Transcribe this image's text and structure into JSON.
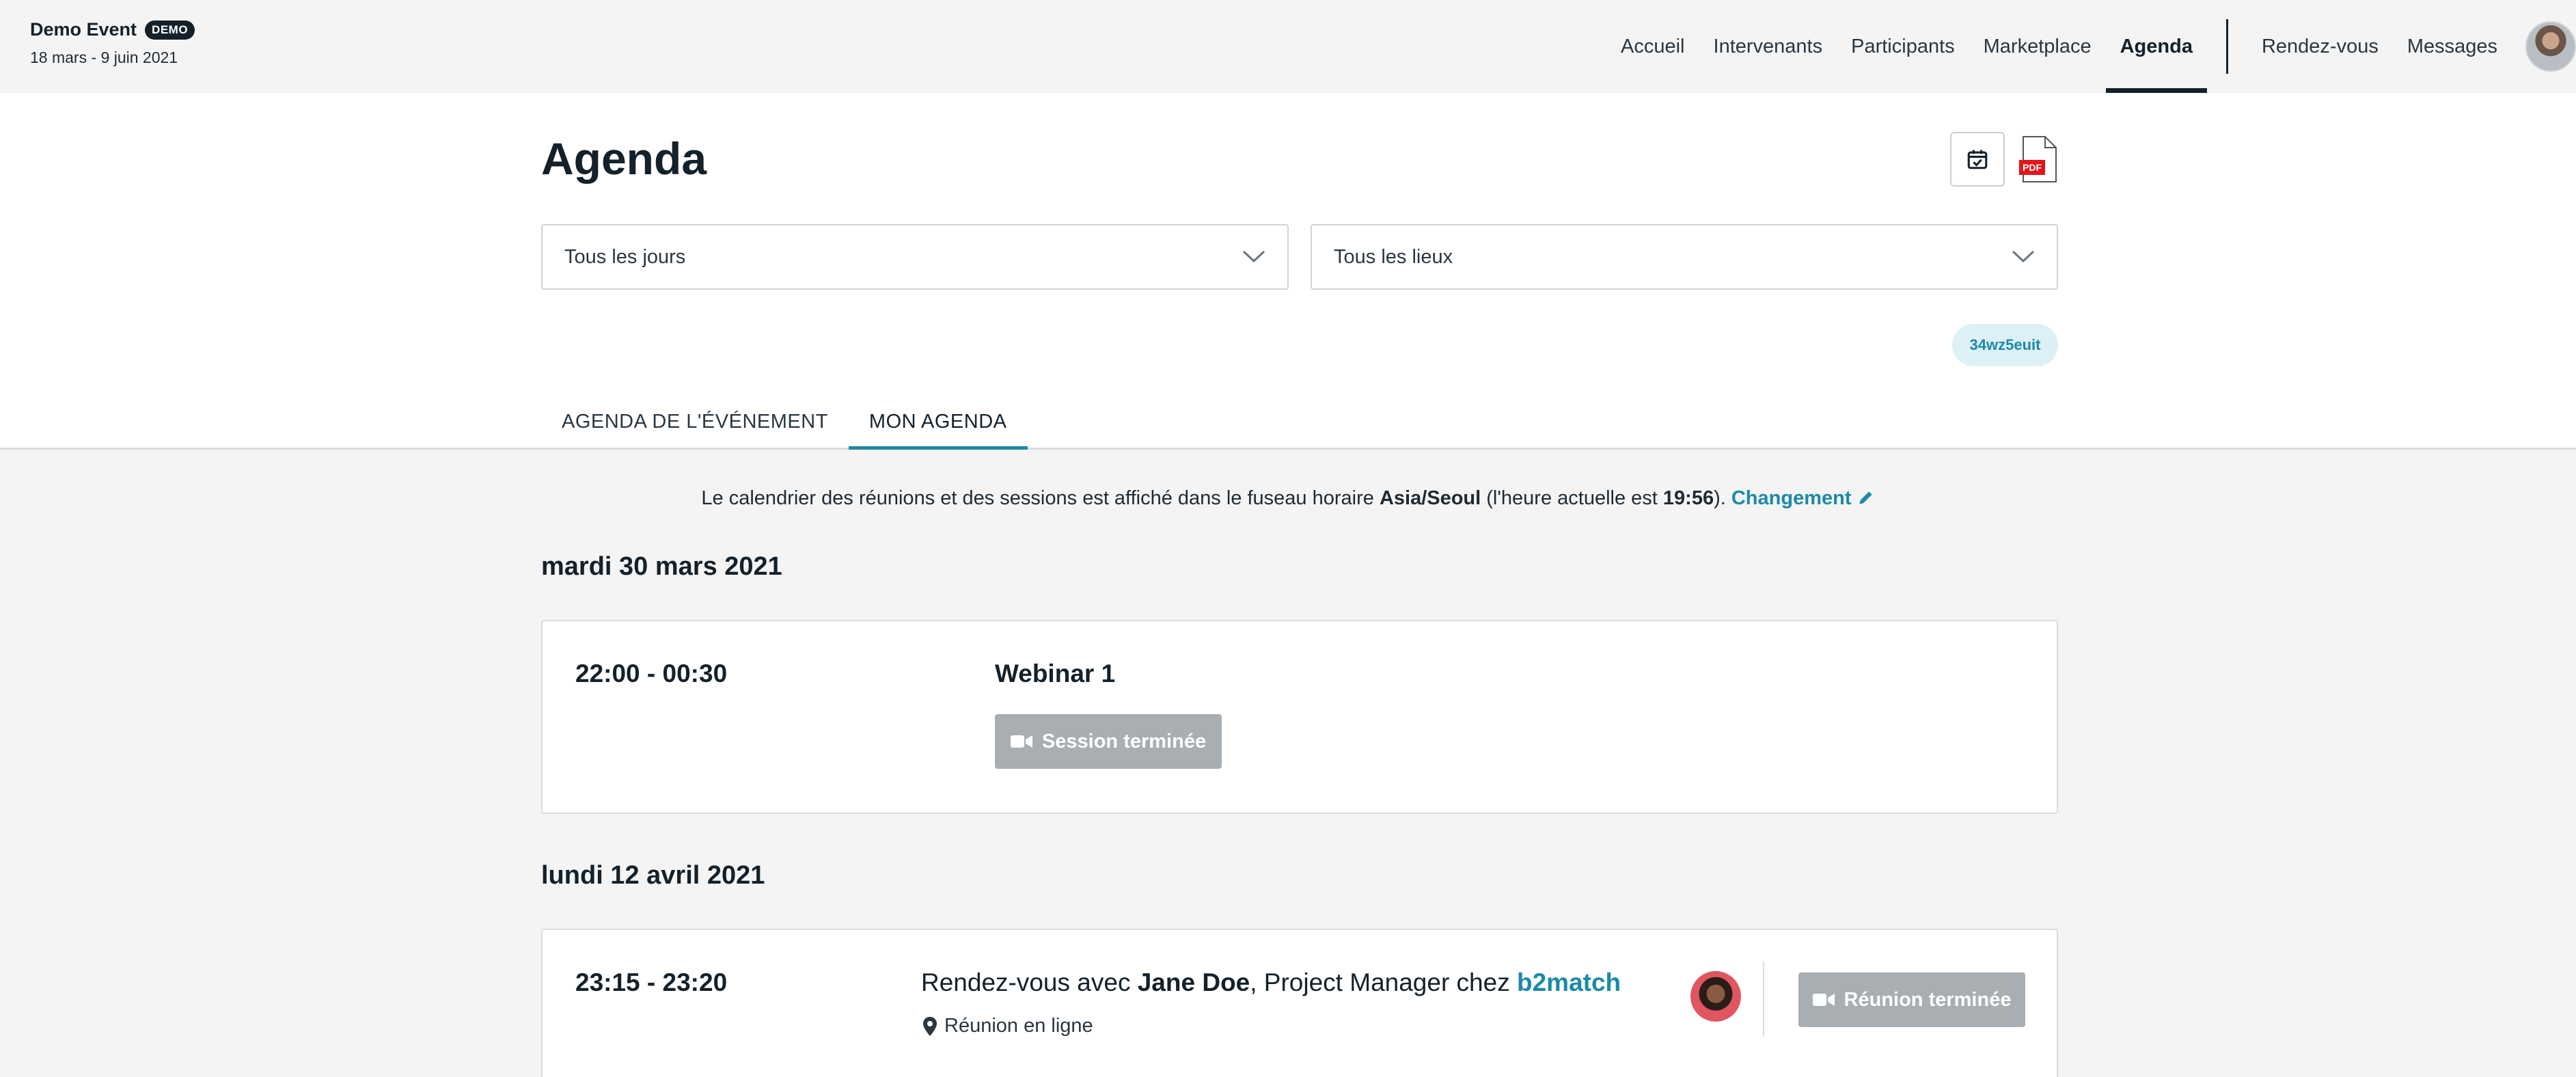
{
  "header": {
    "event_title": "Demo Event",
    "badge": "DEMO",
    "dates": "18 mars - 9 juin 2021",
    "nav": [
      {
        "label": "Accueil",
        "active": false
      },
      {
        "label": "Intervenants",
        "active": false
      },
      {
        "label": "Participants",
        "active": false
      },
      {
        "label": "Marketplace",
        "active": false
      },
      {
        "label": "Agenda",
        "active": true
      }
    ],
    "nav_secondary": [
      {
        "label": "Rendez-vous"
      },
      {
        "label": "Messages"
      }
    ],
    "avatar_icon": "user-avatar"
  },
  "page": {
    "title": "Agenda",
    "calendar_icon": "calendar-check-icon",
    "pdf_icon": "pdf-file-icon",
    "pdf_label": "PDF"
  },
  "filters": {
    "days": "Tous les jours",
    "places": "Tous les lieux"
  },
  "code_badge": "34wz5euit",
  "tabs": [
    {
      "label": "AGENDA DE L'ÉVÉNEMENT",
      "active": false
    },
    {
      "label": "MON AGENDA",
      "active": true
    }
  ],
  "timezone_note": {
    "prefix": "Le calendrier des réunions et des sessions est affiché dans le fuseau horaire ",
    "tz": "Asia/Seoul",
    "mid": " (l'heure actuelle est ",
    "time": "19:56",
    "suffix": "). ",
    "link": "Changement"
  },
  "days": [
    {
      "title": "mardi 30 mars 2021",
      "item": {
        "time": "22:00 - 00:30",
        "title": "Webinar 1",
        "status_button": "Session terminée"
      }
    },
    {
      "title": "lundi 12 avril 2021",
      "item": {
        "time": "23:15 - 23:20",
        "prefix": "Rendez-vous avec ",
        "person": "Jane Doe",
        "role": ", Project Manager chez ",
        "org": "b2match",
        "location": "Réunion en ligne",
        "status_button": "Réunion terminée"
      }
    }
  ],
  "colors": {
    "accent": "#1b8aa7",
    "text_dark": "#14212b",
    "disabled_button": "#a9aeb2",
    "background": "#f4f4f4"
  }
}
